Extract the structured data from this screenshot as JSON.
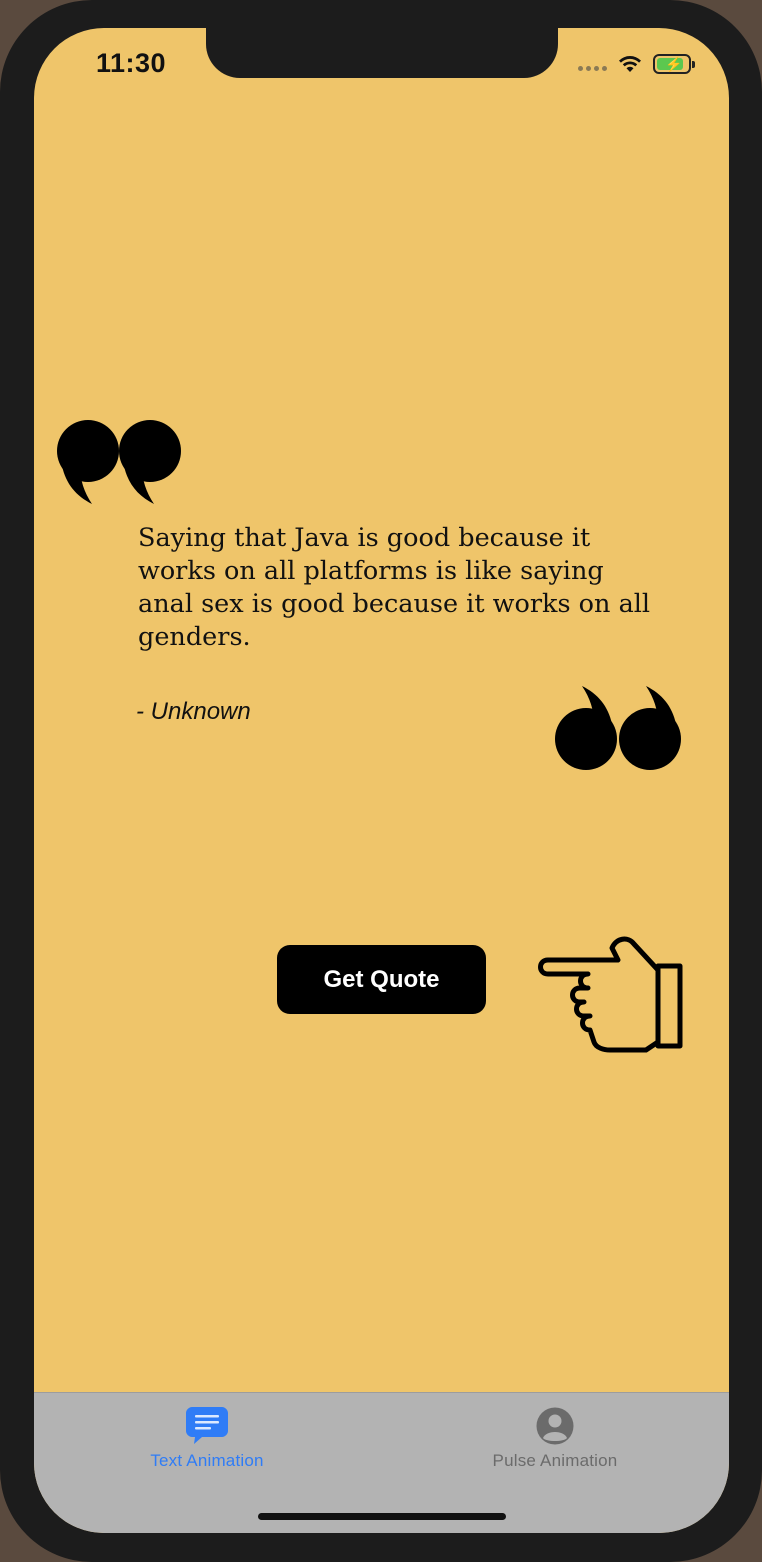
{
  "status_bar": {
    "time": "11:30",
    "battery_level": 0.85,
    "wifi_icon": "wifi-icon",
    "battery_icon": "battery-charging-icon"
  },
  "quote": {
    "text": "Saying that Java is good because it works on all platforms is like saying anal sex is good because it works on all genders.",
    "author": "- Unknown",
    "open_icon": "open-quote-icon",
    "close_icon": "close-quote-icon"
  },
  "action": {
    "button_label": "Get Quote",
    "pointer_icon": "pointing-hand-icon"
  },
  "tab_bar": {
    "tabs": [
      {
        "label": "Text Animation",
        "icon": "message-icon",
        "active": true
      },
      {
        "label": "Pulse Animation",
        "icon": "person-circle-icon",
        "active": false
      }
    ]
  },
  "colors": {
    "background": "#efc56a",
    "tab_bar": "#b3b3b3",
    "active_tab": "#2f7cf6",
    "inactive_tab": "#6b6b6b",
    "button": "#000000",
    "button_text": "#ffffff"
  }
}
